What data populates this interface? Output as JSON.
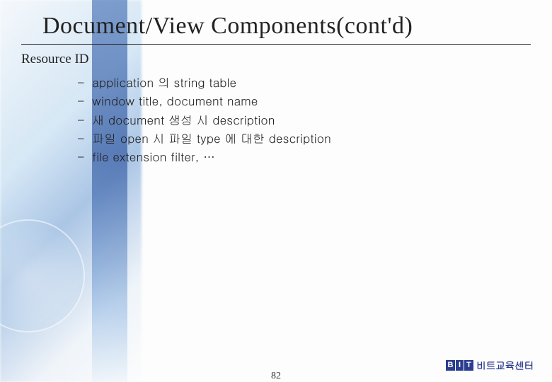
{
  "title": "Document/View Components(cont'd)",
  "section_heading": "Resource ID",
  "bullets": [
    "application 의 string table",
    "window title, document name",
    "새 document 생성 시 description",
    "파일 open 시 파일 type 에 대한 description",
    "file extension filter, …"
  ],
  "page_number": "82",
  "logo": {
    "b": "B",
    "i": "I",
    "t": "T",
    "text": "비트교육센터"
  }
}
